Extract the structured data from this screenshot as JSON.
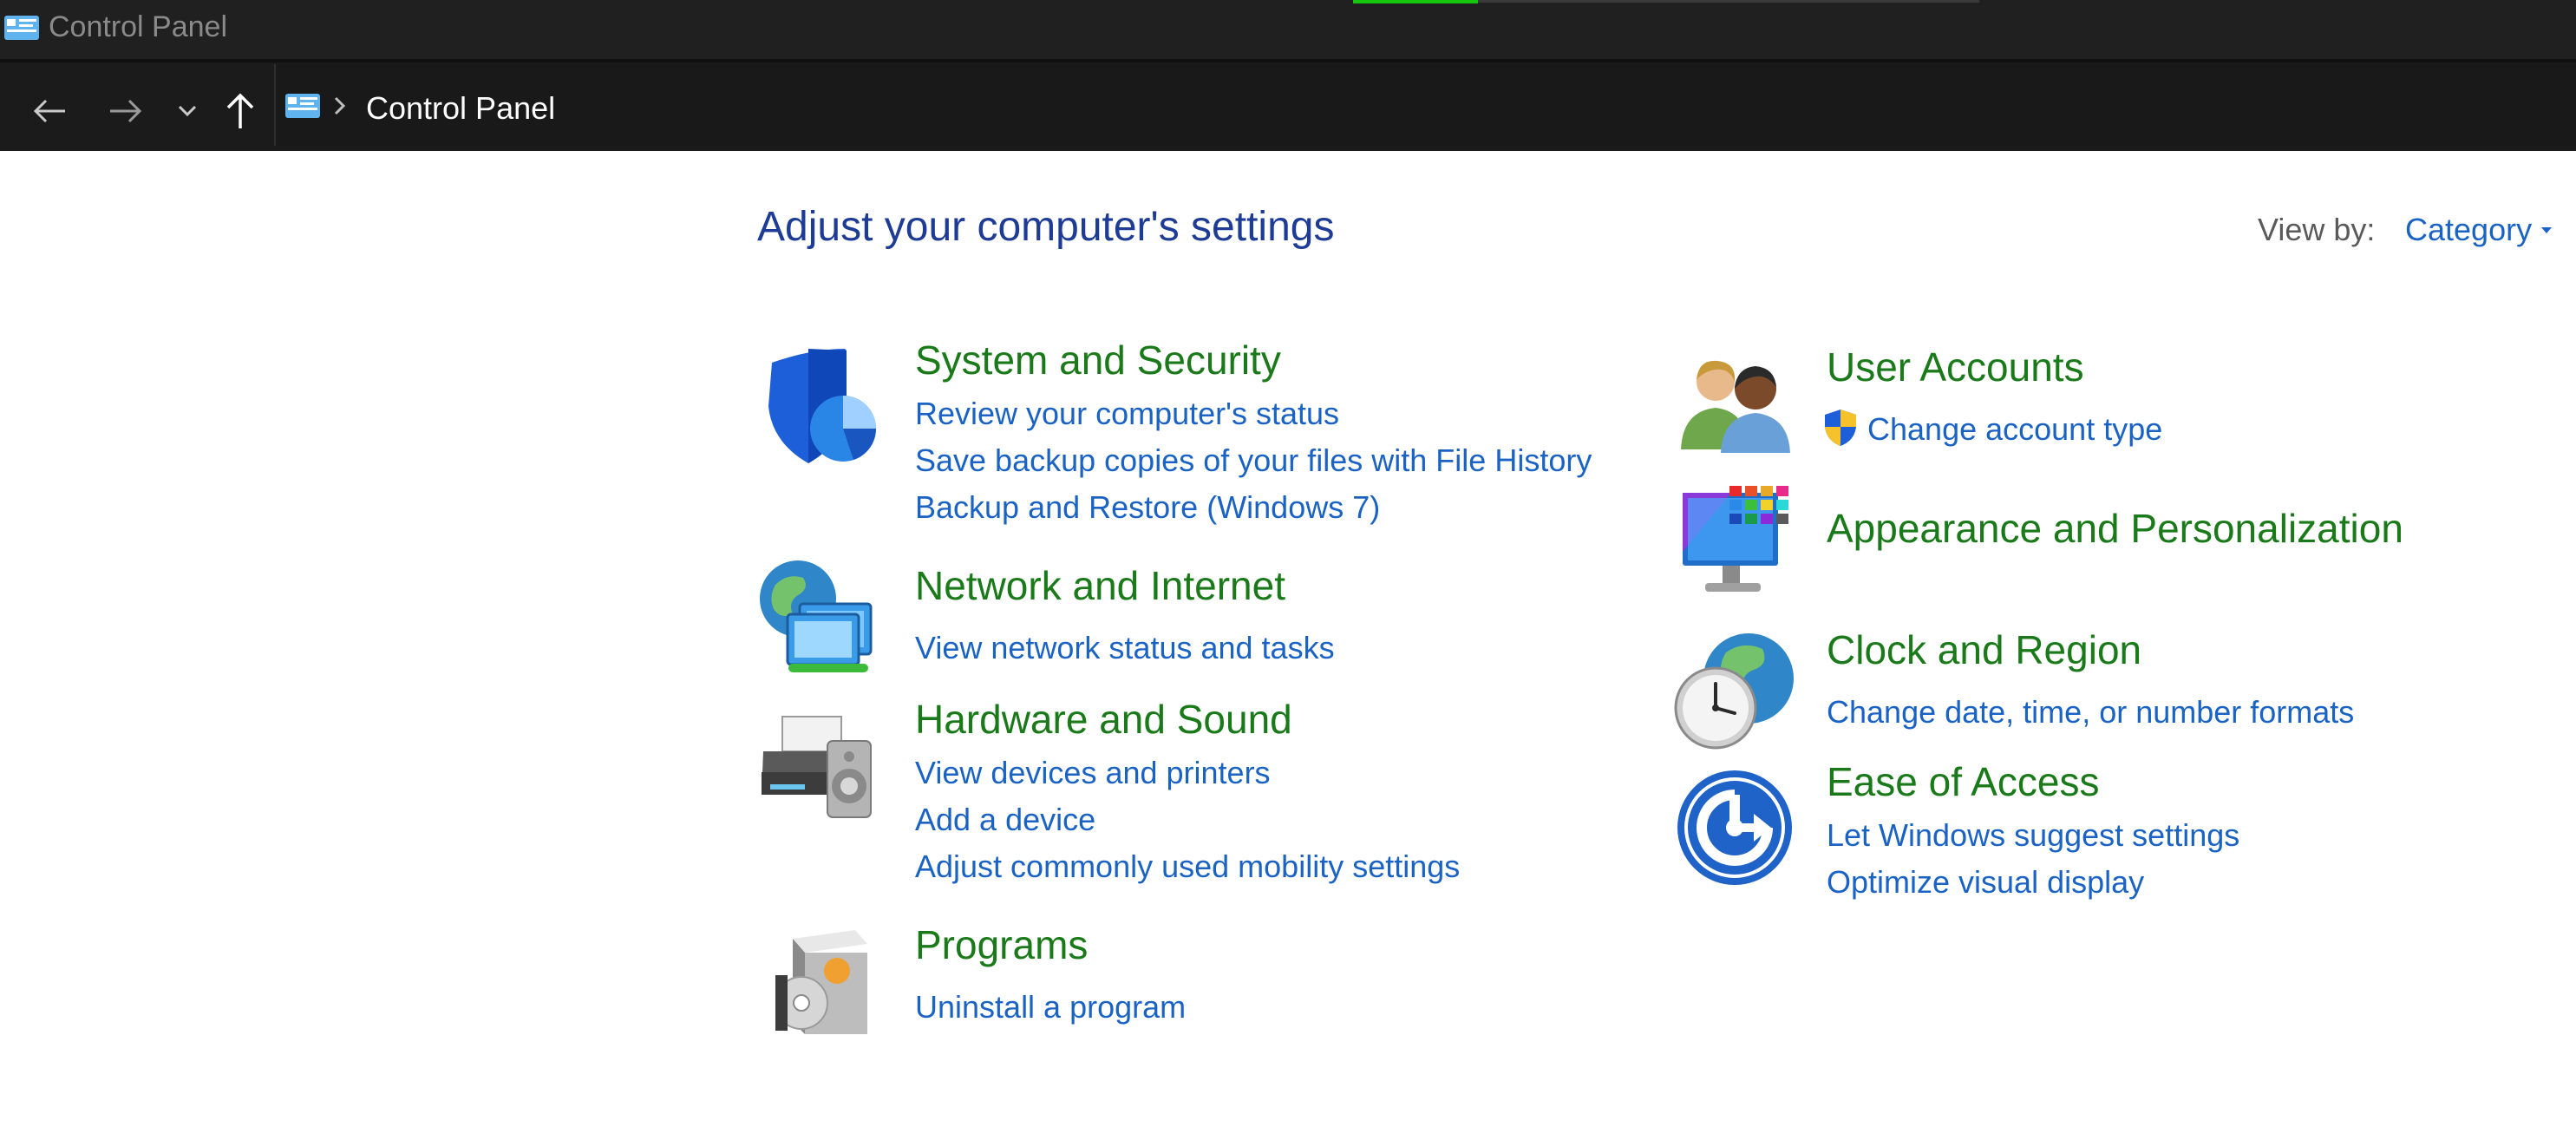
{
  "window": {
    "title": "Control Panel"
  },
  "address_bar": {
    "breadcrumb": "Control Panel"
  },
  "main": {
    "heading": "Adjust your computer's settings",
    "view_by_label": "View by:",
    "view_by_value": "Category"
  },
  "categories": {
    "system_security": {
      "title": "System and Security",
      "icon": "shield-icon",
      "links": [
        "Review your computer's status",
        "Save backup copies of your files with File History",
        "Backup and Restore (Windows 7)"
      ]
    },
    "network_internet": {
      "title": "Network and Internet",
      "icon": "network-globe-icon",
      "links": [
        "View network status and tasks"
      ]
    },
    "hardware_sound": {
      "title": "Hardware and Sound",
      "icon": "printer-speaker-icon",
      "links": [
        "View devices and printers",
        "Add a device",
        "Adjust commonly used mobility settings"
      ]
    },
    "programs": {
      "title": "Programs",
      "icon": "programs-disc-icon",
      "links": [
        "Uninstall a program"
      ]
    },
    "user_accounts": {
      "title": "User Accounts",
      "icon": "users-icon",
      "links": [
        "Change account type"
      ]
    },
    "appearance": {
      "title": "Appearance and Personalization",
      "icon": "monitor-palette-icon",
      "links": []
    },
    "clock_region": {
      "title": "Clock and Region",
      "icon": "clock-globe-icon",
      "links": [
        "Change date, time, or number formats"
      ]
    },
    "ease_access": {
      "title": "Ease of Access",
      "icon": "ease-of-access-icon",
      "links": [
        "Let Windows suggest settings",
        "Optimize visual display"
      ]
    }
  },
  "colors": {
    "titlebar_bg": "#202020",
    "heading": "#1e3c96",
    "category_title": "#1a7a1a",
    "link": "#1a63c4"
  }
}
